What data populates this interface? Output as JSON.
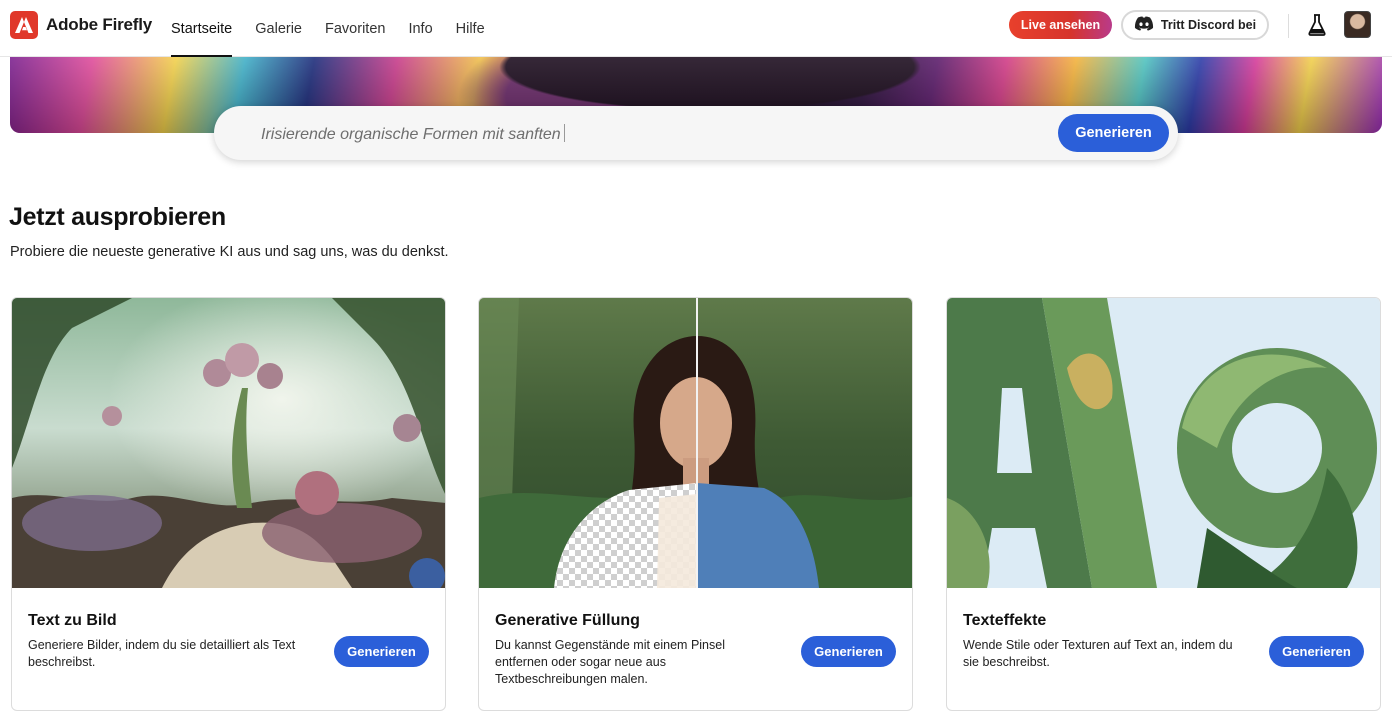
{
  "header": {
    "brand": "Adobe Firefly",
    "nav": [
      {
        "label": "Startseite",
        "active": true
      },
      {
        "label": "Galerie",
        "active": false
      },
      {
        "label": "Favoriten",
        "active": false
      },
      {
        "label": "Info",
        "active": false
      },
      {
        "label": "Hilfe",
        "active": false
      }
    ],
    "live_label": "Live ansehen",
    "discord_label": "Tritt Discord bei"
  },
  "search": {
    "placeholder": "Irisierende organische Formen mit sanften",
    "button_label": "Generieren"
  },
  "section": {
    "title": "Jetzt ausprobieren",
    "subtitle": "Probiere die neueste generative KI aus und sag uns, was du denkst."
  },
  "cards": [
    {
      "title": "Text zu Bild",
      "description": "Generiere Bilder, indem du sie detailliert als Text beschreibst.",
      "button_label": "Generieren"
    },
    {
      "title": "Generative Füllung",
      "description": "Du kannst Gegenstände mit einem Pinsel entfernen oder sogar neue aus Textbeschreibungen malen.",
      "button_label": "Generieren"
    },
    {
      "title": "Texteffekte",
      "description": "Wende Stile oder Texturen auf Text an, indem du sie beschreibst.",
      "button_label": "Generieren"
    }
  ],
  "colors": {
    "accent": "#2b5fd9",
    "brand_red": "#e0382a",
    "live_gradient_start": "#e8402c",
    "live_gradient_end": "#b93a8a"
  },
  "icons": {
    "brand": "adobe-logo-icon",
    "discord": "discord-icon",
    "labs": "flask-icon",
    "avatar": "user-avatar"
  }
}
